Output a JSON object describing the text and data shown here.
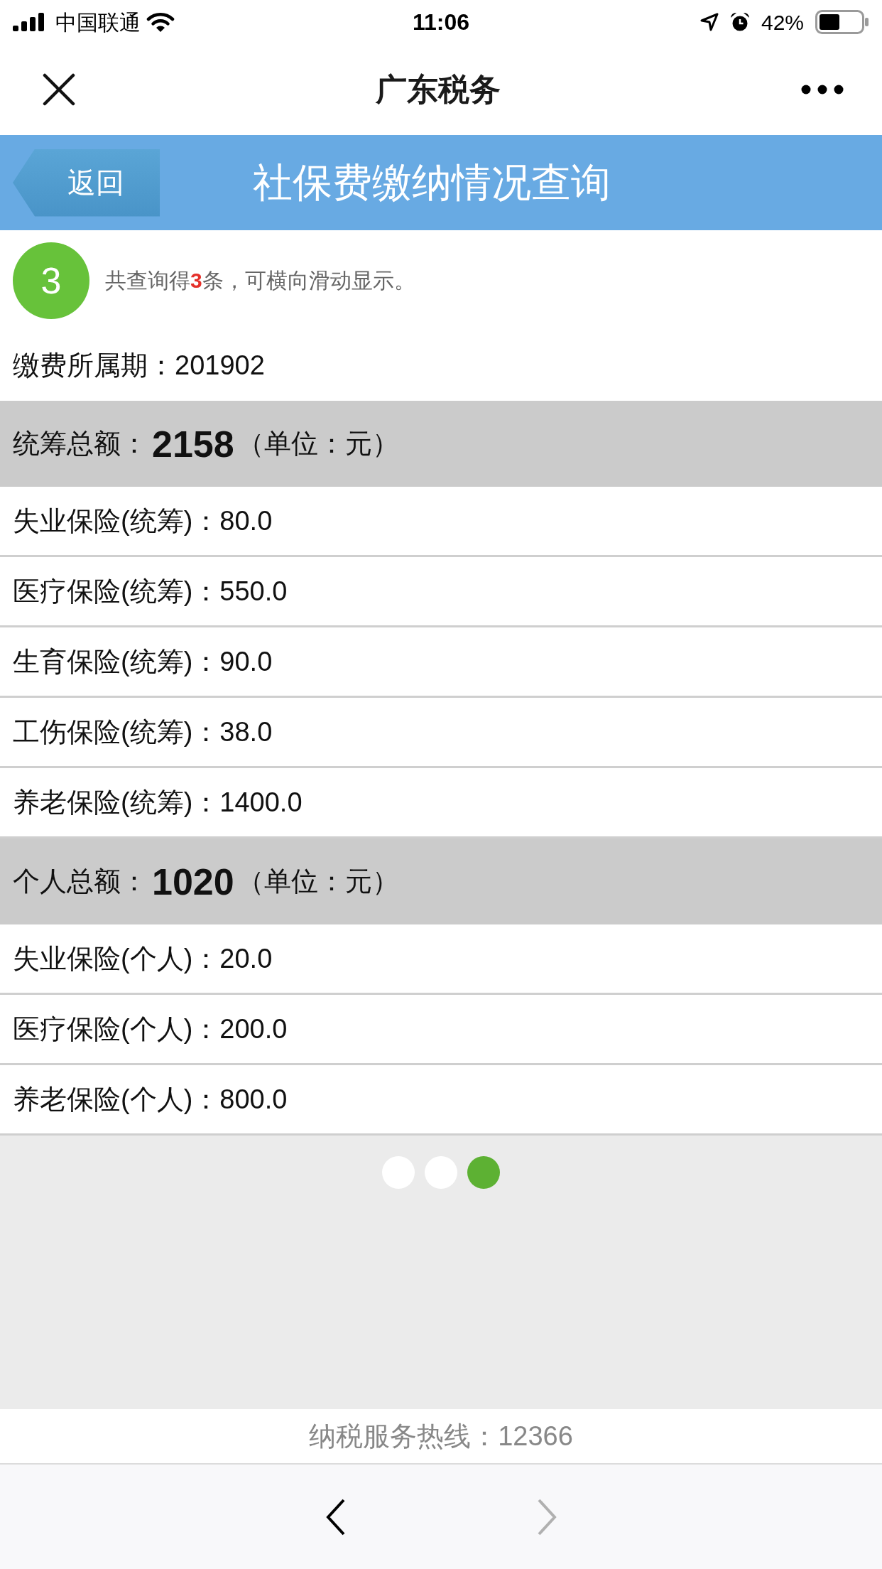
{
  "status_bar": {
    "carrier": "中国联通",
    "time": "11:06",
    "battery": "42%"
  },
  "nav_bar": {
    "title": "广东税务"
  },
  "header": {
    "back_button": "返回",
    "title": "社保费缴纳情况查询"
  },
  "result": {
    "badge": "3",
    "note": "共查询得**3**条，可横向滑动显示。"
  },
  "period": "缴费所属期：201902",
  "sections": [
    {
      "heading": "统筹总额：**2158**（单位：元）",
      "items": [
        "失业保险(统筹)：80.0",
        "医疗保险(统筹)：550.0",
        "生育保险(统筹)：90.0",
        "工伤保险(统筹)：38.0",
        "养老保险(统筹)：1400.0"
      ]
    },
    {
      "heading": "个人总额：**1020**（单位：元）",
      "items": [
        "失业保险(个人)：20.0",
        "医疗保险(个人)：200.0",
        "养老保险(个人)：800.0"
      ]
    }
  ],
  "pager": [
    {
      "selected": false
    },
    {
      "selected": false
    },
    {
      "selected": true
    }
  ],
  "hotline": "纳税服务热线：12366",
  "toolbar": {
    "back": {
      "disabled": false
    },
    "forward": {
      "disabled": true
    }
  }
}
